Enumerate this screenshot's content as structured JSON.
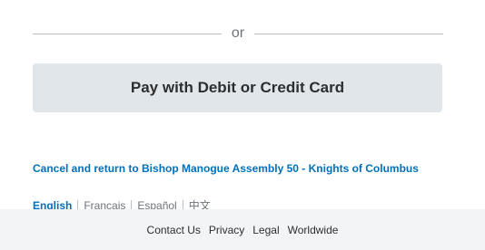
{
  "divider": {
    "text": "or"
  },
  "card_button": {
    "label": "Pay with Debit or Credit Card"
  },
  "cancel_link": {
    "label": "Cancel and return to Bishop Manogue Assembly 50 - Knights of Columbus"
  },
  "languages": {
    "items": [
      "English",
      "Français",
      "Español",
      "中文"
    ],
    "selected": "English"
  },
  "footer": {
    "links": [
      "Contact Us",
      "Privacy",
      "Legal",
      "Worldwide"
    ]
  },
  "colors": {
    "link_blue": "#0070ba",
    "button_bg": "#e1e6ea",
    "footer_bg": "#f2f4f5"
  }
}
